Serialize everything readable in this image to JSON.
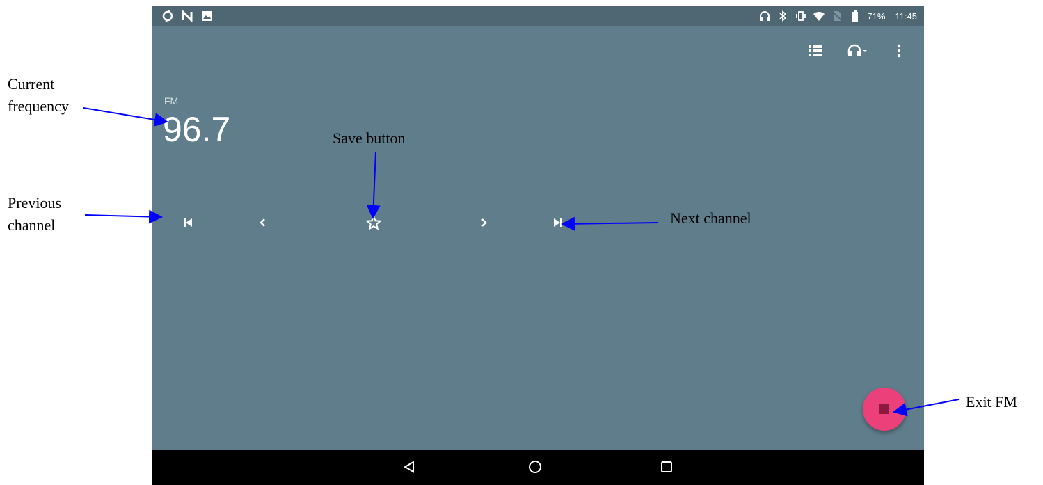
{
  "status_bar": {
    "left_icons": [
      "sync-icon",
      "n-icon",
      "image-icon"
    ],
    "right_icons": [
      "headphones-icon",
      "bluetooth-icon",
      "vibrate-icon",
      "wifi-icon",
      "no-sim-icon",
      "battery-icon"
    ],
    "battery_percent": "71%",
    "time": "11:45"
  },
  "toolbar": {
    "icons": [
      "station-list-icon",
      "headphones-output-icon",
      "more-options-icon"
    ]
  },
  "radio": {
    "band": "FM",
    "frequency": "96.7"
  },
  "controls": {
    "icons": [
      "skip-previous-icon",
      "chevron-left-icon",
      "star-outline-icon",
      "chevron-right-icon",
      "skip-next-icon"
    ]
  },
  "fab": {
    "icon": "stop-icon",
    "color": "#ec407a"
  },
  "nav_bar": {
    "icons": [
      "back-icon",
      "home-icon",
      "recents-icon"
    ]
  },
  "annotations": {
    "current_frequency": "Current\nfrequency",
    "save_button": "Save button",
    "previous_channel": "Previous\nchannel",
    "next_channel": "Next channel",
    "exit_fm": "Exit FM"
  },
  "colors": {
    "background": "#607d8b",
    "status_bar": "#4f6773",
    "annotation_arrow": "#0000ff"
  }
}
